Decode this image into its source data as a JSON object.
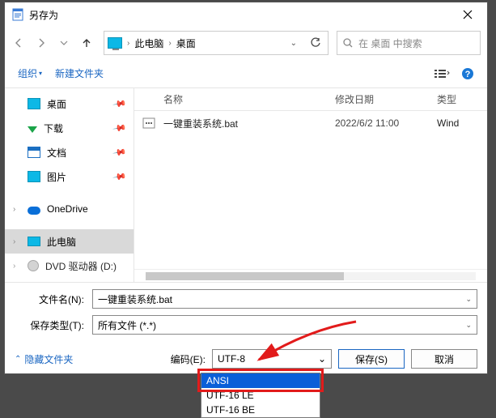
{
  "title": "另存为",
  "breadcrumb": {
    "root": "此电脑",
    "path": "桌面"
  },
  "search": {
    "placeholder": "在 桌面 中搜索"
  },
  "toolbar": {
    "organize": "组织",
    "newfolder": "新建文件夹"
  },
  "sidebar": {
    "items": [
      {
        "label": "桌面"
      },
      {
        "label": "下载"
      },
      {
        "label": "文档"
      },
      {
        "label": "图片"
      },
      {
        "label": "OneDrive"
      },
      {
        "label": "此电脑"
      },
      {
        "label": "DVD 驱动器 (D:)"
      }
    ]
  },
  "columns": {
    "name": "名称",
    "date": "修改日期",
    "type": "类型"
  },
  "files": [
    {
      "name": "一键重装系统.bat",
      "date": "2022/6/2 11:00",
      "type": "Wind"
    }
  ],
  "form": {
    "filename_label": "文件名(N):",
    "filename_value": "一键重装系统.bat",
    "type_label": "保存类型(T):",
    "type_value": "所有文件 (*.*)",
    "encoding_label": "编码(E):",
    "encoding_value": "UTF-8",
    "hide": "隐藏文件夹",
    "save": "保存(S)",
    "cancel": "取消"
  },
  "encoding_options": [
    "ANSI",
    "UTF-16 LE",
    "UTF-16 BE"
  ]
}
